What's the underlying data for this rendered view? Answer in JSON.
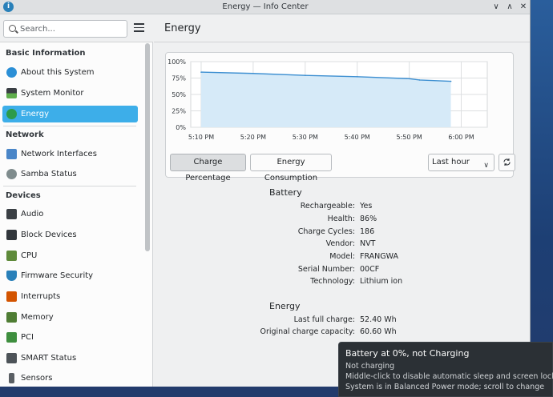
{
  "window": {
    "title": "Energy — Info Center",
    "app_icon": "i"
  },
  "sidebar": {
    "search_placeholder": "Search...",
    "sections": [
      {
        "label": "Basic Information",
        "items": [
          {
            "label": "About this System",
            "icon": "info-icon"
          },
          {
            "label": "System Monitor",
            "icon": "system-monitor-icon"
          },
          {
            "label": "Energy",
            "icon": "energy-icon",
            "selected": true
          }
        ]
      },
      {
        "label": "Network",
        "items": [
          {
            "label": "Network Interfaces",
            "icon": "network-interfaces-icon"
          },
          {
            "label": "Samba Status",
            "icon": "samba-icon"
          }
        ]
      },
      {
        "label": "Devices",
        "items": [
          {
            "label": "Audio",
            "icon": "audio-icon"
          },
          {
            "label": "Block Devices",
            "icon": "block-devices-icon"
          },
          {
            "label": "CPU",
            "icon": "cpu-icon"
          },
          {
            "label": "Firmware Security",
            "icon": "firmware-security-icon"
          },
          {
            "label": "Interrupts",
            "icon": "interrupts-icon"
          },
          {
            "label": "Memory",
            "icon": "memory-icon"
          },
          {
            "label": "PCI",
            "icon": "pci-icon"
          },
          {
            "label": "SMART Status",
            "icon": "smart-status-icon"
          },
          {
            "label": "Sensors",
            "icon": "sensors-icon"
          }
        ]
      }
    ]
  },
  "page": {
    "title": "Energy"
  },
  "chart_data": {
    "type": "area",
    "y_ticks": [
      "100%",
      "75%",
      "50%",
      "25%",
      "0%"
    ],
    "x_ticks": [
      "5:10 PM",
      "5:20 PM",
      "5:30 PM",
      "5:40 PM",
      "5:50 PM",
      "6:00 PM"
    ],
    "ylim": [
      0,
      100
    ],
    "x": [
      "5:10 PM",
      "5:20 PM",
      "5:30 PM",
      "5:40 PM",
      "5:50 PM",
      "5:52 PM",
      "5:58 PM"
    ],
    "values": [
      84,
      82,
      79,
      77,
      74,
      72,
      70
    ],
    "grid": true,
    "line_color": "#3d8fd1",
    "fill_color": "#d6eaf8"
  },
  "controls": {
    "charge_percentage": "Charge Percentage",
    "energy_consumption": "Energy Consumption",
    "range_selected": "Last hour",
    "refresh_icon": "refresh-icon"
  },
  "battery": {
    "title": "Battery",
    "rows": [
      {
        "key": "Rechargeable:",
        "value": "Yes"
      },
      {
        "key": "Health:",
        "value": "86%"
      },
      {
        "key": "Charge Cycles:",
        "value": "186"
      },
      {
        "key": "Vendor:",
        "value": "NVT"
      },
      {
        "key": "Model:",
        "value": "FRANGWA"
      },
      {
        "key": "Serial Number:",
        "value": "00CF"
      },
      {
        "key": "Technology:",
        "value": "Lithium ion"
      }
    ]
  },
  "energy": {
    "title": "Energy",
    "rows": [
      {
        "key": "Last full charge:",
        "value": "52.40 Wh"
      },
      {
        "key": "Original charge capacity:",
        "value": "60.60 Wh"
      }
    ]
  },
  "tooltip": {
    "title": "Battery at 0%, not Charging",
    "line1": "Not charging",
    "line2": "Middle-click to disable automatic sleep and screen locking",
    "line3": "System is in Balanced Power mode; scroll to change"
  }
}
